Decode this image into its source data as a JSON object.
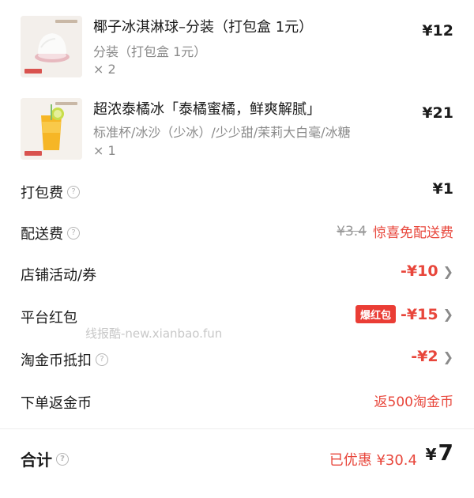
{
  "items": [
    {
      "name": "椰子冰淇淋球–分装（打包盒 1元）",
      "spec": "分装（打包盒 1元）",
      "qty": "× 2",
      "price": "¥12",
      "image": "coconut-ice-cream-ball-image"
    },
    {
      "name": "超浓泰橘冰「泰橘蜜橘，鲜爽解腻」",
      "spec": "标准杯/冰沙（少冰）/少少甜/茉莉大白毫/冰糖",
      "qty": "× 1",
      "price": "¥21",
      "image": "orange-iced-drink-image"
    }
  ],
  "fees": {
    "packaging": {
      "label": "打包费",
      "value": "¥1"
    },
    "delivery": {
      "label": "配送费",
      "original": "¥3.4",
      "promo": "惊喜免配送费"
    },
    "store_coupon": {
      "label": "店铺活动/券",
      "value": "-¥10"
    },
    "platform_redpacket": {
      "label": "平台红包",
      "badge": "爆红包",
      "value": "-¥15"
    },
    "taojinbi": {
      "label": "淘金币抵扣",
      "value": "-¥2"
    },
    "cashback": {
      "label": "下单返金币",
      "value": "返500淘金币"
    }
  },
  "watermark": "线报酷-new.xianbao.fun",
  "total": {
    "label": "合计",
    "saved": "已优惠 ¥30.4",
    "currency": "¥",
    "amount": "7"
  },
  "colors": {
    "accent_red": "#e8463b",
    "badge_red": "#ea3d35",
    "text": "#1a1a1a",
    "muted": "#8a8a8a"
  },
  "icons": [
    "question-circle-icon",
    "chevron-right-icon"
  ]
}
